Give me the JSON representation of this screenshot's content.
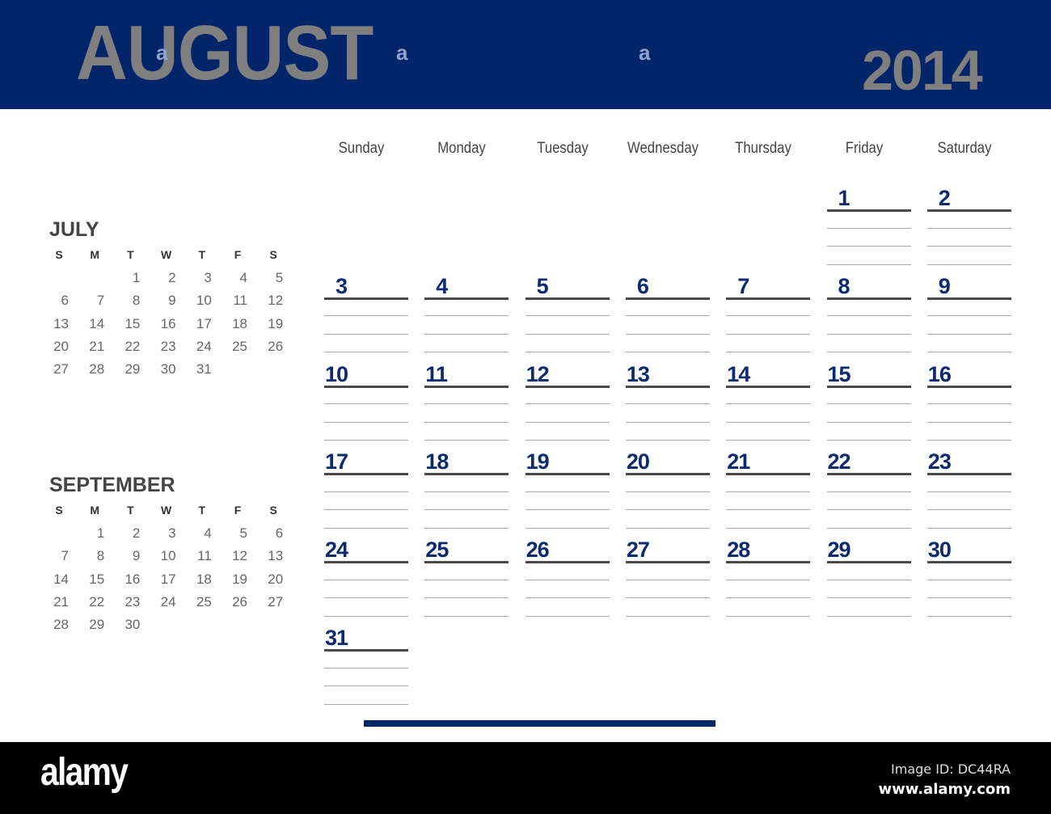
{
  "header": {
    "month": "AUGUST",
    "year": "2014",
    "background_color": "#022569",
    "title_color": "#7f7f7f",
    "watermark_glyph": "a"
  },
  "weekdays": [
    "Sunday",
    "Monday",
    "Tuesday",
    "Wednesday",
    "Thursday",
    "Friday",
    "Saturday"
  ],
  "main_calendar": {
    "month": "August",
    "year": 2014,
    "first_weekday_index": 5,
    "days_in_month": 31,
    "weeks": [
      [
        "",
        "",
        "",
        "",
        "",
        "1",
        "2"
      ],
      [
        "3",
        "4",
        "5",
        "6",
        "7",
        "8",
        "9"
      ],
      [
        "10",
        "11",
        "12",
        "13",
        "14",
        "15",
        "16"
      ],
      [
        "17",
        "18",
        "19",
        "20",
        "21",
        "22",
        "23"
      ],
      [
        "24",
        "25",
        "26",
        "27",
        "28",
        "29",
        "30"
      ],
      [
        "31",
        "",
        "",
        "",
        "",
        "",
        ""
      ]
    ],
    "note_lines_per_day": 3,
    "number_color": "#0b2a6f"
  },
  "mini_calendars": [
    {
      "title": "JULY",
      "weekday_initials": [
        "S",
        "M",
        "T",
        "W",
        "T",
        "F",
        "S"
      ],
      "weeks": [
        [
          "",
          "",
          "1",
          "2",
          "3",
          "4",
          "5"
        ],
        [
          "6",
          "7",
          "8",
          "9",
          "10",
          "11",
          "12"
        ],
        [
          "13",
          "14",
          "15",
          "16",
          "17",
          "18",
          "19"
        ],
        [
          "20",
          "21",
          "22",
          "23",
          "24",
          "25",
          "26"
        ],
        [
          "27",
          "28",
          "29",
          "30",
          "31",
          "",
          ""
        ]
      ]
    },
    {
      "title": "SEPTEMBER",
      "weekday_initials": [
        "S",
        "M",
        "T",
        "W",
        "T",
        "F",
        "S"
      ],
      "weeks": [
        [
          "",
          "1",
          "2",
          "3",
          "4",
          "5",
          "6"
        ],
        [
          "7",
          "8",
          "9",
          "10",
          "11",
          "12",
          "13"
        ],
        [
          "14",
          "15",
          "16",
          "17",
          "18",
          "19",
          "20"
        ],
        [
          "21",
          "22",
          "23",
          "24",
          "25",
          "26",
          "27"
        ],
        [
          "28",
          "29",
          "30",
          "",
          "",
          "",
          ""
        ]
      ]
    }
  ],
  "footer": {
    "brand": "alamy",
    "image_id": "Image ID: DC44RA",
    "url": "www.alamy.com"
  }
}
